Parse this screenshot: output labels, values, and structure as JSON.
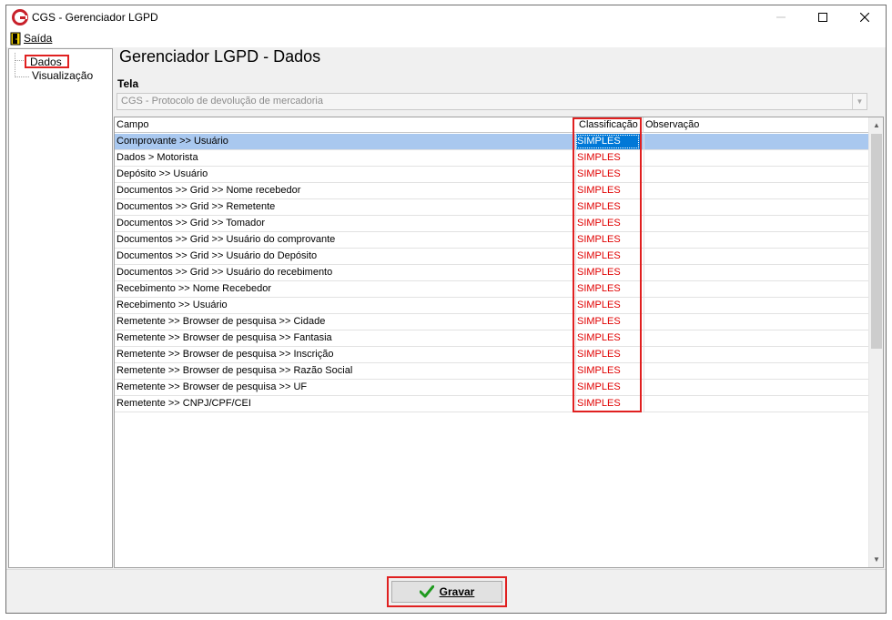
{
  "window": {
    "title": "CGS - Gerenciador LGPD",
    "controls": {
      "minimize": "—",
      "maximize": "☐",
      "close": "✕"
    }
  },
  "menu": {
    "exit_label": "Saída"
  },
  "tree": {
    "items": [
      {
        "label": "Dados",
        "selected": true
      },
      {
        "label": "Visualização",
        "selected": false
      }
    ]
  },
  "main": {
    "heading": "Gerenciador LGPD - Dados",
    "tela_label": "Tela",
    "tela_value": "CGS - Protocolo de devolução de mercadoria"
  },
  "grid": {
    "columns": {
      "campo": "Campo",
      "classificacao": "Classificação",
      "observacao": "Observação"
    },
    "rows": [
      {
        "campo": "Comprovante >> Usuário",
        "classificacao": "SIMPLES",
        "observacao": "",
        "selected": true
      },
      {
        "campo": "Dados > Motorista",
        "classificacao": "SIMPLES",
        "observacao": ""
      },
      {
        "campo": "Depósito >> Usuário",
        "classificacao": "SIMPLES",
        "observacao": ""
      },
      {
        "campo": "Documentos >> Grid >> Nome recebedor",
        "classificacao": "SIMPLES",
        "observacao": ""
      },
      {
        "campo": "Documentos >> Grid >> Remetente",
        "classificacao": "SIMPLES",
        "observacao": ""
      },
      {
        "campo": "Documentos >> Grid >> Tomador",
        "classificacao": "SIMPLES",
        "observacao": ""
      },
      {
        "campo": "Documentos >> Grid >> Usuário do comprovante",
        "classificacao": "SIMPLES",
        "observacao": ""
      },
      {
        "campo": "Documentos >> Grid >> Usuário do Depósito",
        "classificacao": "SIMPLES",
        "observacao": ""
      },
      {
        "campo": "Documentos >> Grid >> Usuário do recebimento",
        "classificacao": "SIMPLES",
        "observacao": ""
      },
      {
        "campo": "Recebimento >> Nome Recebedor",
        "classificacao": "SIMPLES",
        "observacao": ""
      },
      {
        "campo": "Recebimento >> Usuário",
        "classificacao": "SIMPLES",
        "observacao": ""
      },
      {
        "campo": "Remetente >> Browser de pesquisa >> Cidade",
        "classificacao": "SIMPLES",
        "observacao": ""
      },
      {
        "campo": "Remetente >> Browser de pesquisa >> Fantasia",
        "classificacao": "SIMPLES",
        "observacao": ""
      },
      {
        "campo": "Remetente >> Browser de pesquisa >> Inscrição",
        "classificacao": "SIMPLES",
        "observacao": ""
      },
      {
        "campo": "Remetente >> Browser de pesquisa >> Razão Social",
        "classificacao": "SIMPLES",
        "observacao": ""
      },
      {
        "campo": "Remetente >> Browser de pesquisa >> UF",
        "classificacao": "SIMPLES",
        "observacao": ""
      },
      {
        "campo": "Remetente >> CNPJ/CPF/CEI",
        "classificacao": "SIMPLES",
        "observacao": ""
      }
    ]
  },
  "footer": {
    "save_label": "Gravar"
  },
  "colors": {
    "highlight_red": "#e02020",
    "classification_red": "#e00000",
    "selection_blue": "#0078d7",
    "row_selection": "#a9c8ef",
    "app_icon_red": "#c8202a"
  }
}
